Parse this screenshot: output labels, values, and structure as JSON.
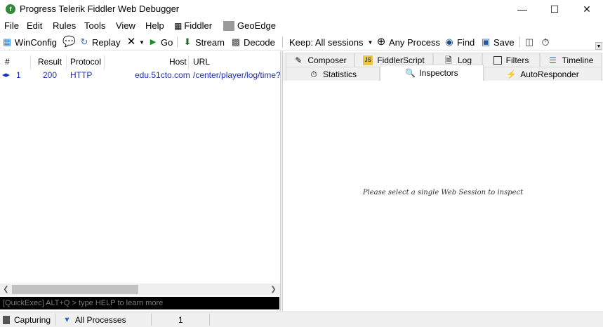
{
  "window": {
    "title": "Progress Telerik Fiddler Web Debugger",
    "app_icon": "fiddler-logo-icon",
    "controls": [
      "minimize-icon",
      "maximize-icon",
      "close-icon"
    ]
  },
  "menu": [
    "File",
    "Edit",
    "Rules",
    "Tools",
    "View",
    "Help",
    "Fiddler",
    "GeoEdge"
  ],
  "toolbar": {
    "winconfig": "WinConfig",
    "replay": "Replay",
    "go": "Go",
    "stream": "Stream",
    "decode": "Decode",
    "keep": "Keep: All sessions",
    "any_process": "Any Process",
    "find": "Find",
    "save": "Save"
  },
  "sessions": {
    "columns": [
      "#",
      "Result",
      "Protocol",
      "Host",
      "URL"
    ],
    "rows": [
      {
        "id": "1",
        "result": "200",
        "protocol": "HTTP",
        "host": "edu.51cto.com",
        "url": "/center/player/log/time?ty"
      }
    ]
  },
  "quickexec": {
    "placeholder": "[QuickExec] ALT+Q > type HELP to learn more"
  },
  "tabs": {
    "row1": [
      "Composer",
      "FiddlerScript",
      "Log",
      "Filters",
      "Timeline"
    ],
    "row2": [
      "Statistics",
      "Inspectors",
      "AutoResponder"
    ],
    "active": "Inspectors"
  },
  "inspector_message": "Please select a single Web Session to inspect",
  "status": {
    "capturing": "Capturing",
    "processes": "All Processes",
    "count": "1"
  },
  "colors": {
    "session_text": "#1c2fb8",
    "quickexec_bg": "#000000",
    "status_bg": "#f0f0f0"
  }
}
